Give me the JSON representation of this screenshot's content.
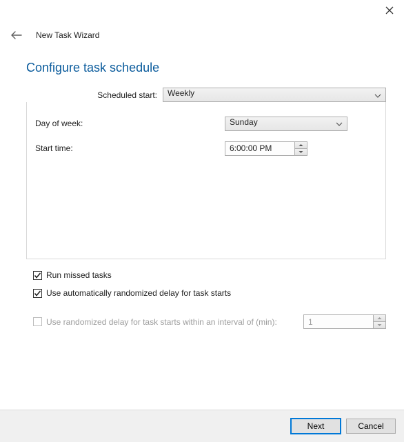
{
  "window": {
    "title": "New Task Wizard"
  },
  "heading": "Configure task schedule",
  "schedule": {
    "label": "Scheduled start:",
    "selected": "Weekly"
  },
  "panel": {
    "day_label": "Day of week:",
    "day_value": "Sunday",
    "time_label": "Start time:",
    "time_value": "6:00:00 PM"
  },
  "options": {
    "run_missed": {
      "label": "Run missed tasks",
      "checked": true
    },
    "auto_random": {
      "label": "Use automatically randomized delay for task starts",
      "checked": true
    },
    "interval_random": {
      "label": "Use randomized delay for task starts within an interval of (min):",
      "checked": false,
      "value": "1"
    }
  },
  "buttons": {
    "next": "Next",
    "cancel": "Cancel"
  }
}
